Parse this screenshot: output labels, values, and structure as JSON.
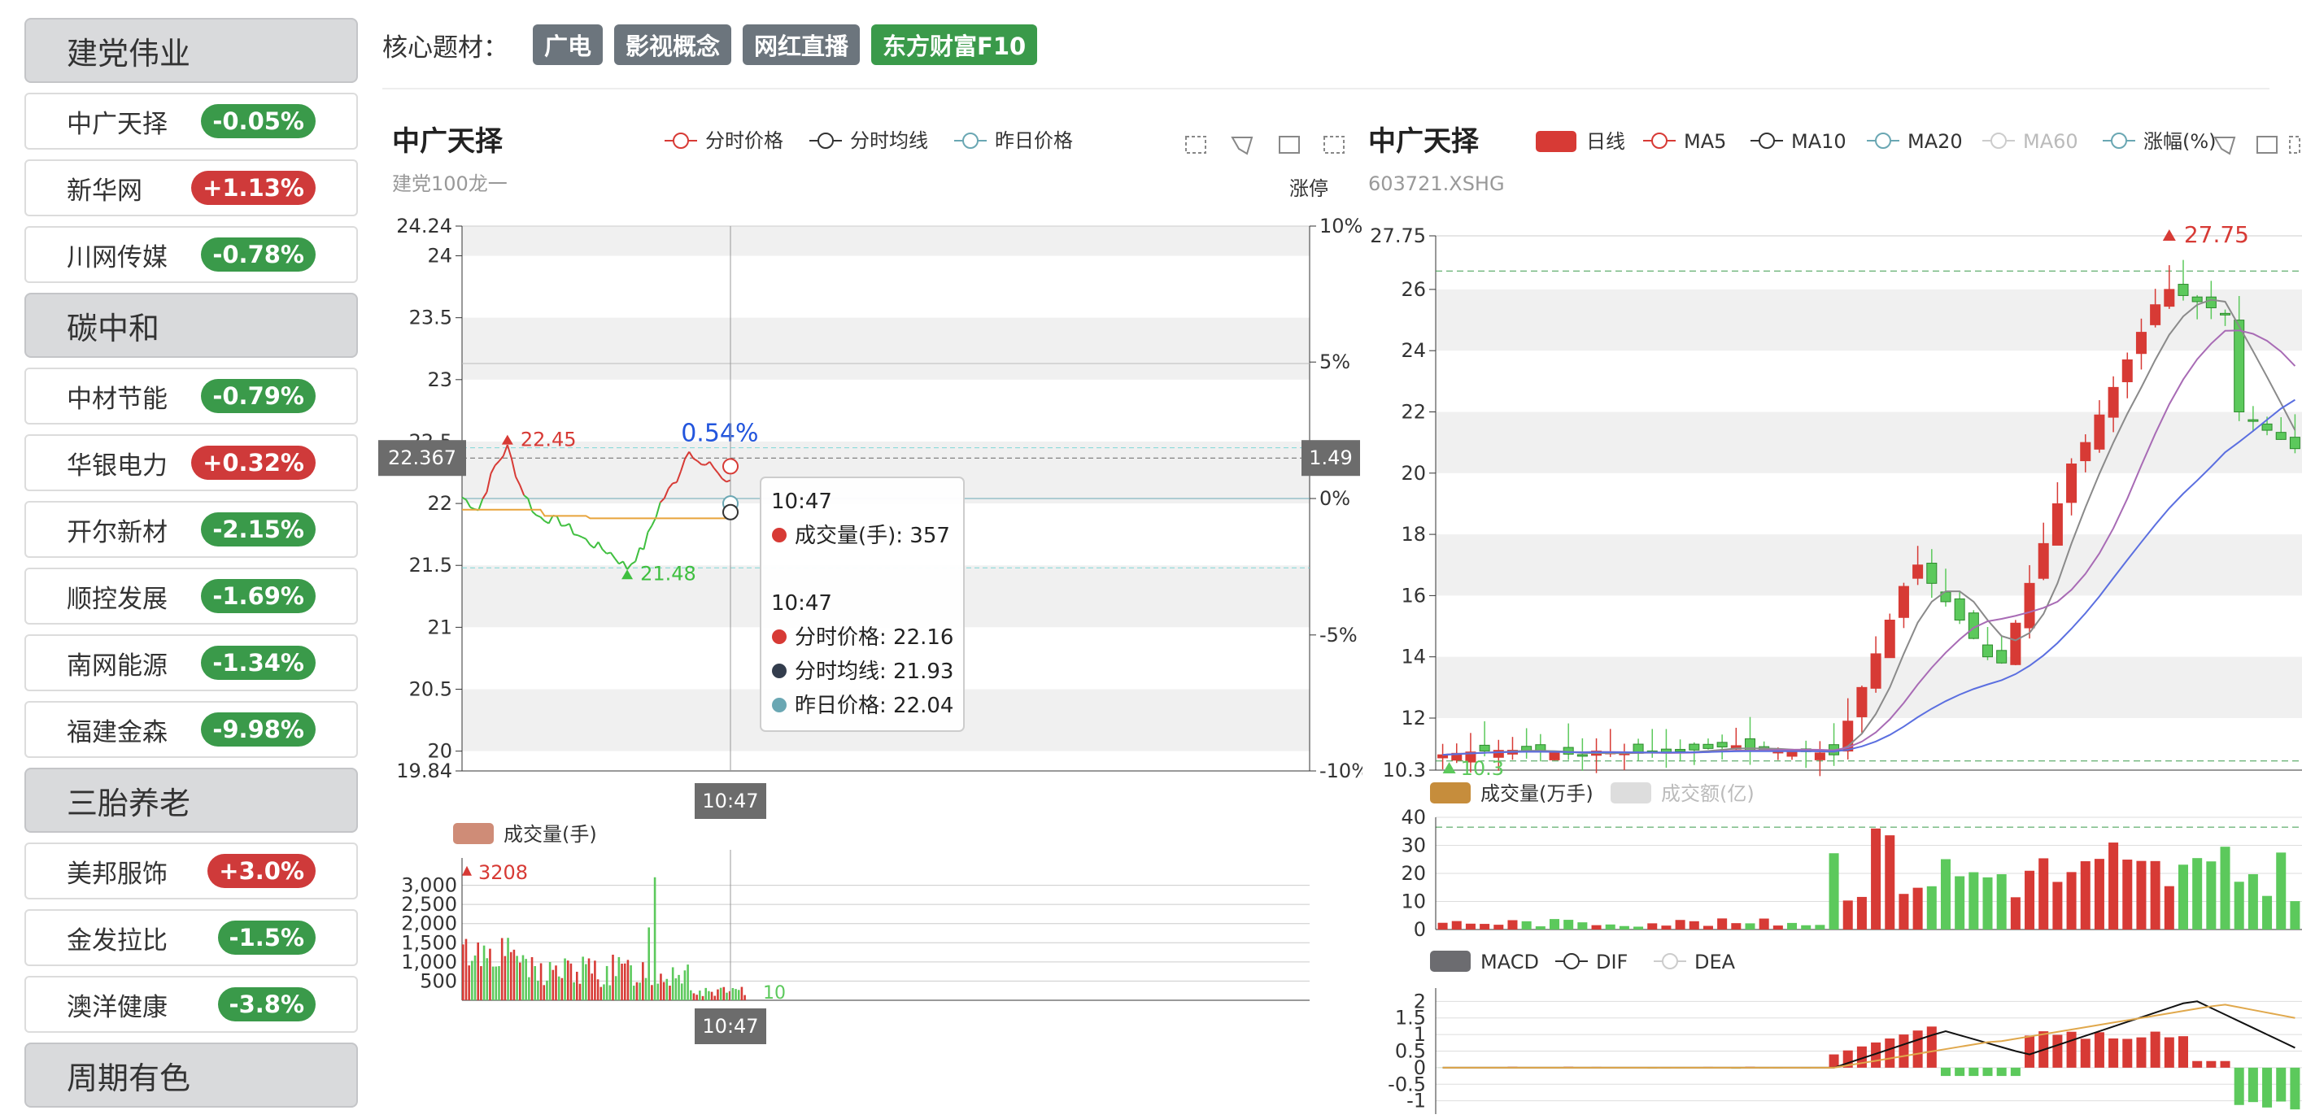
{
  "sidebar": {
    "groups": [
      {
        "name": "建党伟业",
        "items": [
          {
            "name": "中广天择",
            "pct": "-0.05%",
            "dir": "down"
          },
          {
            "name": "新华网",
            "pct": "+1.13%",
            "dir": "up"
          },
          {
            "name": "川网传媒",
            "pct": "-0.78%",
            "dir": "down"
          }
        ]
      },
      {
        "name": "碳中和",
        "items": [
          {
            "name": "中材节能",
            "pct": "-0.79%",
            "dir": "down"
          },
          {
            "name": "华银电力",
            "pct": "+0.32%",
            "dir": "up"
          },
          {
            "name": "开尔新材",
            "pct": "-2.15%",
            "dir": "down"
          },
          {
            "name": "顺控发展",
            "pct": "-1.69%",
            "dir": "down"
          },
          {
            "name": "南网能源",
            "pct": "-1.34%",
            "dir": "down"
          },
          {
            "name": "福建金森",
            "pct": "-9.98%",
            "dir": "down"
          }
        ]
      },
      {
        "name": "三胎养老",
        "items": [
          {
            "name": "美邦服饰",
            "pct": "+3.0%",
            "dir": "up"
          },
          {
            "name": "金发拉比",
            "pct": "-1.5%",
            "dir": "down"
          },
          {
            "name": "澳洋健康",
            "pct": "-3.8%",
            "dir": "down"
          }
        ]
      },
      {
        "name": "周期有色",
        "items": []
      }
    ]
  },
  "topics": {
    "label": "核心题材：",
    "tags": [
      "广电",
      "影视概念",
      "网红直播",
      "东方财富F10"
    ]
  },
  "intraday": {
    "title": "中广天择",
    "subtitle": "建党100龙一",
    "right_label": "涨停",
    "legend": [
      "分时价格",
      "分时均线",
      "昨日价格"
    ],
    "colors": {
      "price": "#d73a35",
      "price_down": "#3fbf3f",
      "avg": "#e8a43c",
      "prev": "#6aa7b3"
    },
    "y_ticks": [
      "24.24",
      "24",
      "23.5",
      "23",
      "22.5",
      "22",
      "21.5",
      "21",
      "20.5",
      "20",
      "19.84"
    ],
    "y_right_ticks": [
      "10%",
      "5%",
      "0%",
      "-5%",
      "-10%"
    ],
    "cursor_price": "22.367",
    "cursor_pct": "1.49",
    "cursor_time": "10:47",
    "high_mark": "22.45",
    "low_mark": "21.48",
    "pct_mark": "0.54%",
    "tooltip": {
      "t1": "10:47",
      "vol_label": "成交量(手): 357",
      "t2": "10:47",
      "price_label": "分时价格: 22.16",
      "avg_label": "分时均线: 21.93",
      "prev_label": "昨日价格: 22.04"
    },
    "vol_legend": "成交量(手)",
    "vol_ticks": [
      "3,000",
      "2,500",
      "2,000",
      "1,500",
      "1,000",
      "500"
    ],
    "vol_max": "3208",
    "vol_tail": "10",
    "vol_time": "10:47",
    "chart_data": {
      "type": "line",
      "yprev": 22.04,
      "ylim": [
        19.84,
        24.24
      ],
      "current_price": 22.16,
      "current_avg": 21.93
    }
  },
  "daily": {
    "title": "中广天择",
    "code": "603721.XSHG",
    "legend": [
      "日线",
      "MA5",
      "MA10",
      "MA20",
      "MA60",
      "涨幅(%)"
    ],
    "y_ticks": [
      "27.75",
      "26",
      "24",
      "22",
      "20",
      "18",
      "16",
      "14",
      "12",
      "10.3"
    ],
    "high_mark": "27.75",
    "low_mark": "10.3",
    "vol_legend": [
      "成交量(万手)",
      "成交额(亿)"
    ],
    "vol_ticks": [
      "40",
      "30",
      "20",
      "10",
      "0"
    ],
    "macd_legend": [
      "MACD",
      "DIF",
      "DEA"
    ],
    "macd_ticks": [
      "2",
      "1.5",
      "1",
      "0.5",
      "0",
      "-0.5",
      "-1"
    ],
    "colors": {
      "up": "#d73a35",
      "down": "#5cc95c",
      "ma5": "#8a8a8a",
      "ma10": "#a86bb5",
      "ma20": "#5b6fe0",
      "vol": "#c68d3c"
    },
    "chart_data": {
      "type": "candlestick",
      "ylim": [
        10.3,
        27.75
      ]
    }
  }
}
